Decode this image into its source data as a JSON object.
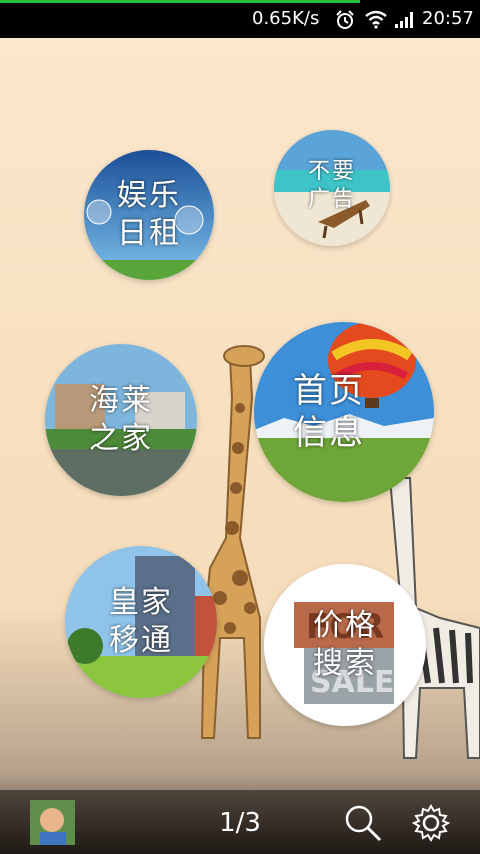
{
  "status_bar": {
    "speed": "0.65K/s",
    "time": "20:57",
    "icons": [
      "alarm-icon",
      "wifi-icon",
      "signal-icon"
    ]
  },
  "tiles": [
    {
      "id": "entertainment",
      "line1": "娱乐",
      "line2": "日租"
    },
    {
      "id": "no-ads",
      "line1": "不要",
      "line2": "广告"
    },
    {
      "id": "hailai-home",
      "line1": "海莱",
      "line2": "之家"
    },
    {
      "id": "home-info",
      "line1": "首页",
      "line2": "信息"
    },
    {
      "id": "royal-mobile",
      "line1": "皇家",
      "line2": "移通"
    },
    {
      "id": "price-search",
      "line1": "价格",
      "line2": "搜索"
    }
  ],
  "bottom_bar": {
    "page_indicator": "1/3",
    "icons": [
      "avatar",
      "search-icon",
      "gear-icon"
    ]
  },
  "colors": {
    "background": "#fbe6c9",
    "status_bar": "#000000",
    "progress": "#22c23a"
  }
}
